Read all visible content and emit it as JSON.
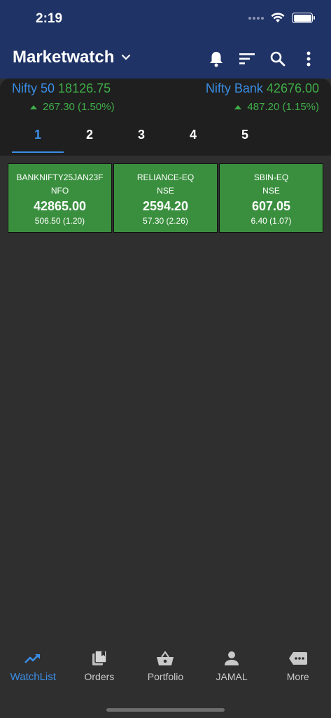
{
  "status": {
    "time": "2:19"
  },
  "header": {
    "title": "Marketwatch"
  },
  "indices": [
    {
      "name": "Nifty 50",
      "value": "18126.75",
      "change": "267.30 (1.50%)"
    },
    {
      "name": "Nifty Bank",
      "value": "42676.00",
      "change": "487.20 (1.15%)"
    }
  ],
  "tabs": [
    {
      "label": "1",
      "active": true
    },
    {
      "label": "2"
    },
    {
      "label": "3"
    },
    {
      "label": "4"
    },
    {
      "label": "5"
    }
  ],
  "tiles": [
    {
      "symbol": "BANKNIFTY25JAN23F",
      "exchange": "NFO",
      "ltp": "42865.00",
      "change": "506.50 (1.20)"
    },
    {
      "symbol": "RELIANCE-EQ",
      "exchange": "NSE",
      "ltp": "2594.20",
      "change": "57.30 (2.26)"
    },
    {
      "symbol": "SBIN-EQ",
      "exchange": "NSE",
      "ltp": "607.05",
      "change": "6.40 (1.07)"
    }
  ],
  "nav": [
    {
      "label": "WatchList",
      "icon": "trending-up-icon",
      "active": true
    },
    {
      "label": "Orders",
      "icon": "orders-icon"
    },
    {
      "label": "Portfolio",
      "icon": "basket-icon"
    },
    {
      "label": "JAMAL",
      "icon": "person-icon"
    },
    {
      "label": "More",
      "icon": "more-icon"
    }
  ],
  "colors": {
    "header": "#1f3366",
    "accent": "#3a8ee6",
    "positive": "#3fae49",
    "tile": "#3a8f3e",
    "background": "#2f2f2f"
  }
}
